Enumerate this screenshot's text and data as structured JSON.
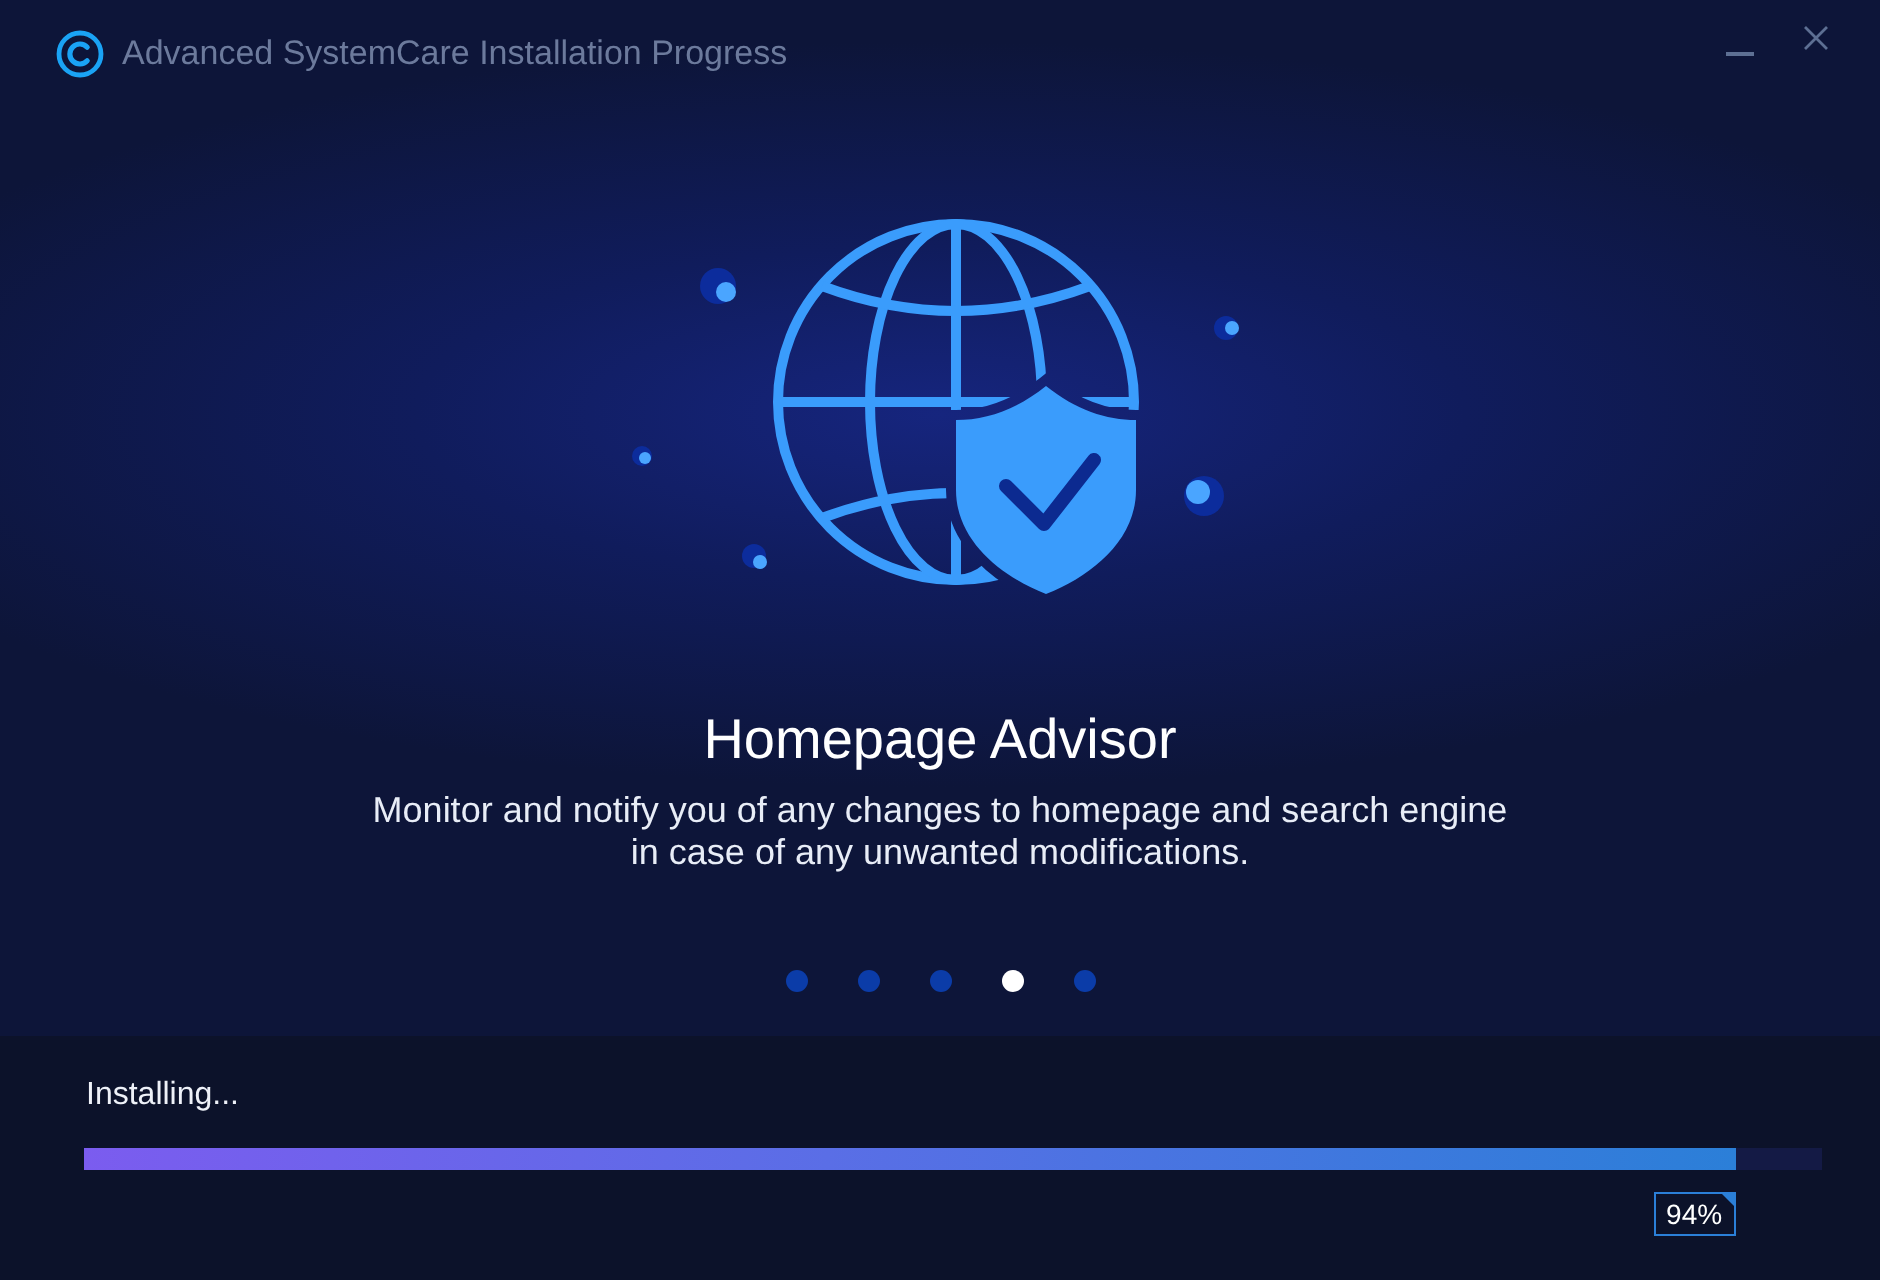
{
  "window": {
    "title": "Advanced SystemCare Installation Progress"
  },
  "feature": {
    "title": "Homepage Advisor",
    "description": "Monitor and notify you of any changes to homepage and search engine in case of any unwanted modifications."
  },
  "carousel": {
    "dots": [
      {
        "selected": false
      },
      {
        "selected": false
      },
      {
        "selected": false
      },
      {
        "selected": true
      },
      {
        "selected": false
      }
    ]
  },
  "progress": {
    "label": "Installing...",
    "level": 0.95,
    "reading": "94%"
  }
}
